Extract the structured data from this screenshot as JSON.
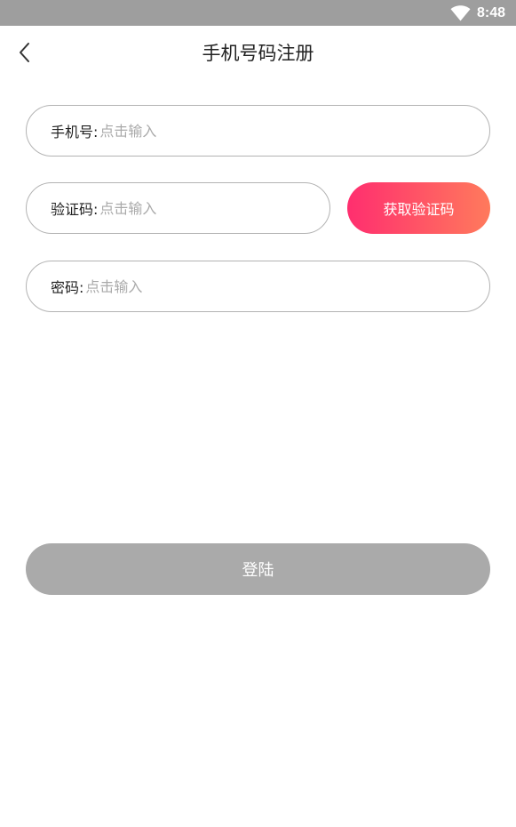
{
  "status_bar": {
    "time": "8:48",
    "wifi_icon": "wifi-icon"
  },
  "header": {
    "title": "手机号码注册",
    "back_icon": "chevron-left-icon"
  },
  "form": {
    "phone": {
      "label": "手机号:",
      "placeholder": "点击输入",
      "value": ""
    },
    "code": {
      "label": "验证码:",
      "placeholder": "点击输入",
      "value": ""
    },
    "get_code_label": "获取验证码",
    "password": {
      "label": "密码:",
      "placeholder": "点击输入",
      "value": ""
    }
  },
  "login_label": "登陆",
  "colors": {
    "status_bar": "#9e9e9e",
    "accent_start": "#ff2e6f",
    "accent_end": "#ff7a5c",
    "disabled_button": "#aaaaaa",
    "field_border": "#b3b3b3"
  }
}
